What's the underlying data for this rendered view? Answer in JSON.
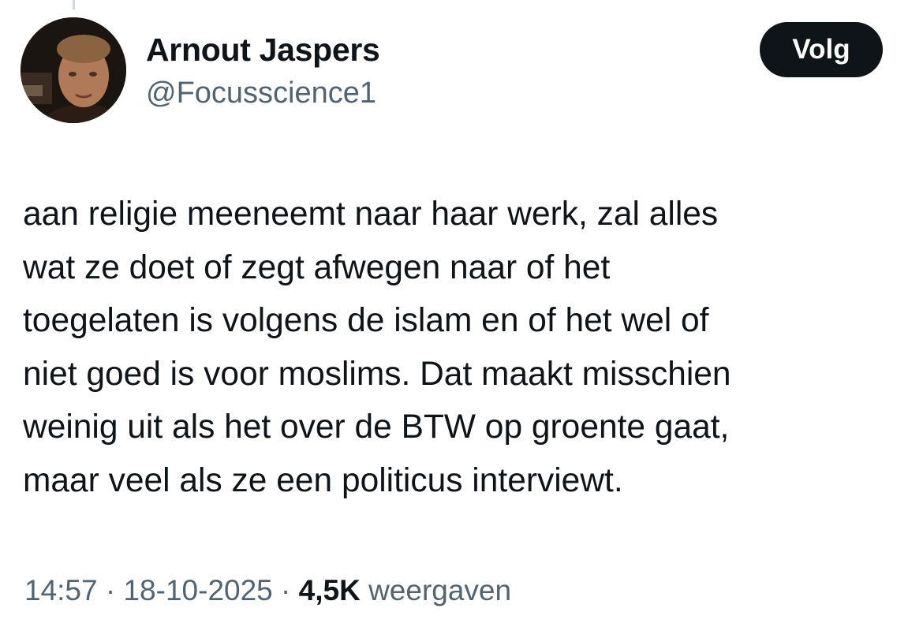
{
  "author": {
    "name": "Arnout Jaspers",
    "handle": "@Focusscience1"
  },
  "follow_button": {
    "label": "Volg"
  },
  "tweet": {
    "lines": [
      "aan religie meeneemt naar haar werk, zal alles",
      "wat ze doet of zegt afwegen naar of het",
      "toegelaten is volgens de islam en of het wel of",
      "niet goed is voor moslims. Dat maakt misschien",
      "weinig uit als het over de BTW op groente gaat,",
      "maar veel als ze een politicus interviewt."
    ]
  },
  "meta": {
    "time": "14:57",
    "separator": "·",
    "date": "18-10-2025",
    "views_count": "4,5K",
    "views_label": "weergaven"
  },
  "colors": {
    "text_primary": "#0f1419",
    "text_secondary": "#536471",
    "button_bg": "#0f1419",
    "button_text": "#ffffff"
  }
}
